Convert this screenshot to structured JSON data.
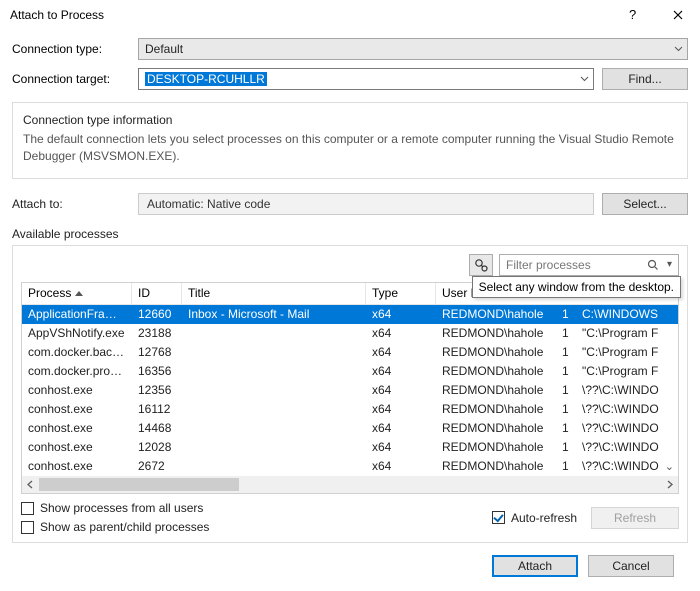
{
  "dialog": {
    "title": "Attach to Process"
  },
  "labels": {
    "connection_type": "Connection type:",
    "connection_target": "Connection target:",
    "attach_to": "Attach to:",
    "available_processes": "Available processes",
    "conn_info_legend": "Connection type information"
  },
  "connection": {
    "type_value": "Default",
    "target_value": "DESKTOP-RCUHLLR",
    "info_text": "The default connection lets you select processes on this computer or a remote computer running the Visual Studio Remote Debugger (MSVSMON.EXE)."
  },
  "buttons": {
    "find": "Find...",
    "select": "Select...",
    "refresh": "Refresh",
    "attach": "Attach",
    "cancel": "Cancel"
  },
  "attach": {
    "value": "Automatic: Native code"
  },
  "filter": {
    "placeholder": "Filter processes"
  },
  "columns": {
    "process": "Process",
    "id": "ID",
    "title": "Title",
    "type": "Type",
    "user": "User Name"
  },
  "rows": [
    {
      "process": "ApplicationFrameHo...",
      "id": "12660",
      "title": "Inbox - Microsoft - Mail",
      "type": "x64",
      "user": "REDMOND\\hahole",
      "session": "1",
      "path": "C:\\WINDOWS"
    },
    {
      "process": "AppVShNotify.exe",
      "id": "23188",
      "title": "",
      "type": "x64",
      "user": "REDMOND\\hahole",
      "session": "1",
      "path": "\"C:\\Program F"
    },
    {
      "process": "com.docker.backend...",
      "id": "12768",
      "title": "",
      "type": "x64",
      "user": "REDMOND\\hahole",
      "session": "1",
      "path": "\"C:\\Program F"
    },
    {
      "process": "com.docker.proxy.exe",
      "id": "16356",
      "title": "",
      "type": "x64",
      "user": "REDMOND\\hahole",
      "session": "1",
      "path": "\"C:\\Program F"
    },
    {
      "process": "conhost.exe",
      "id": "12356",
      "title": "",
      "type": "x64",
      "user": "REDMOND\\hahole",
      "session": "1",
      "path": "\\??\\C:\\WINDO"
    },
    {
      "process": "conhost.exe",
      "id": "16112",
      "title": "",
      "type": "x64",
      "user": "REDMOND\\hahole",
      "session": "1",
      "path": "\\??\\C:\\WINDO"
    },
    {
      "process": "conhost.exe",
      "id": "14468",
      "title": "",
      "type": "x64",
      "user": "REDMOND\\hahole",
      "session": "1",
      "path": "\\??\\C:\\WINDO"
    },
    {
      "process": "conhost.exe",
      "id": "12028",
      "title": "",
      "type": "x64",
      "user": "REDMOND\\hahole",
      "session": "1",
      "path": "\\??\\C:\\WINDO"
    },
    {
      "process": "conhost.exe",
      "id": "2672",
      "title": "",
      "type": "x64",
      "user": "REDMOND\\hahole",
      "session": "1",
      "path": "\\??\\C:\\WINDO"
    }
  ],
  "options": {
    "show_all_users": "Show processes from all users",
    "show_parent_child": "Show as parent/child processes",
    "auto_refresh": "Auto-refresh"
  },
  "tooltip": {
    "select_window": "Select any window from the desktop."
  }
}
